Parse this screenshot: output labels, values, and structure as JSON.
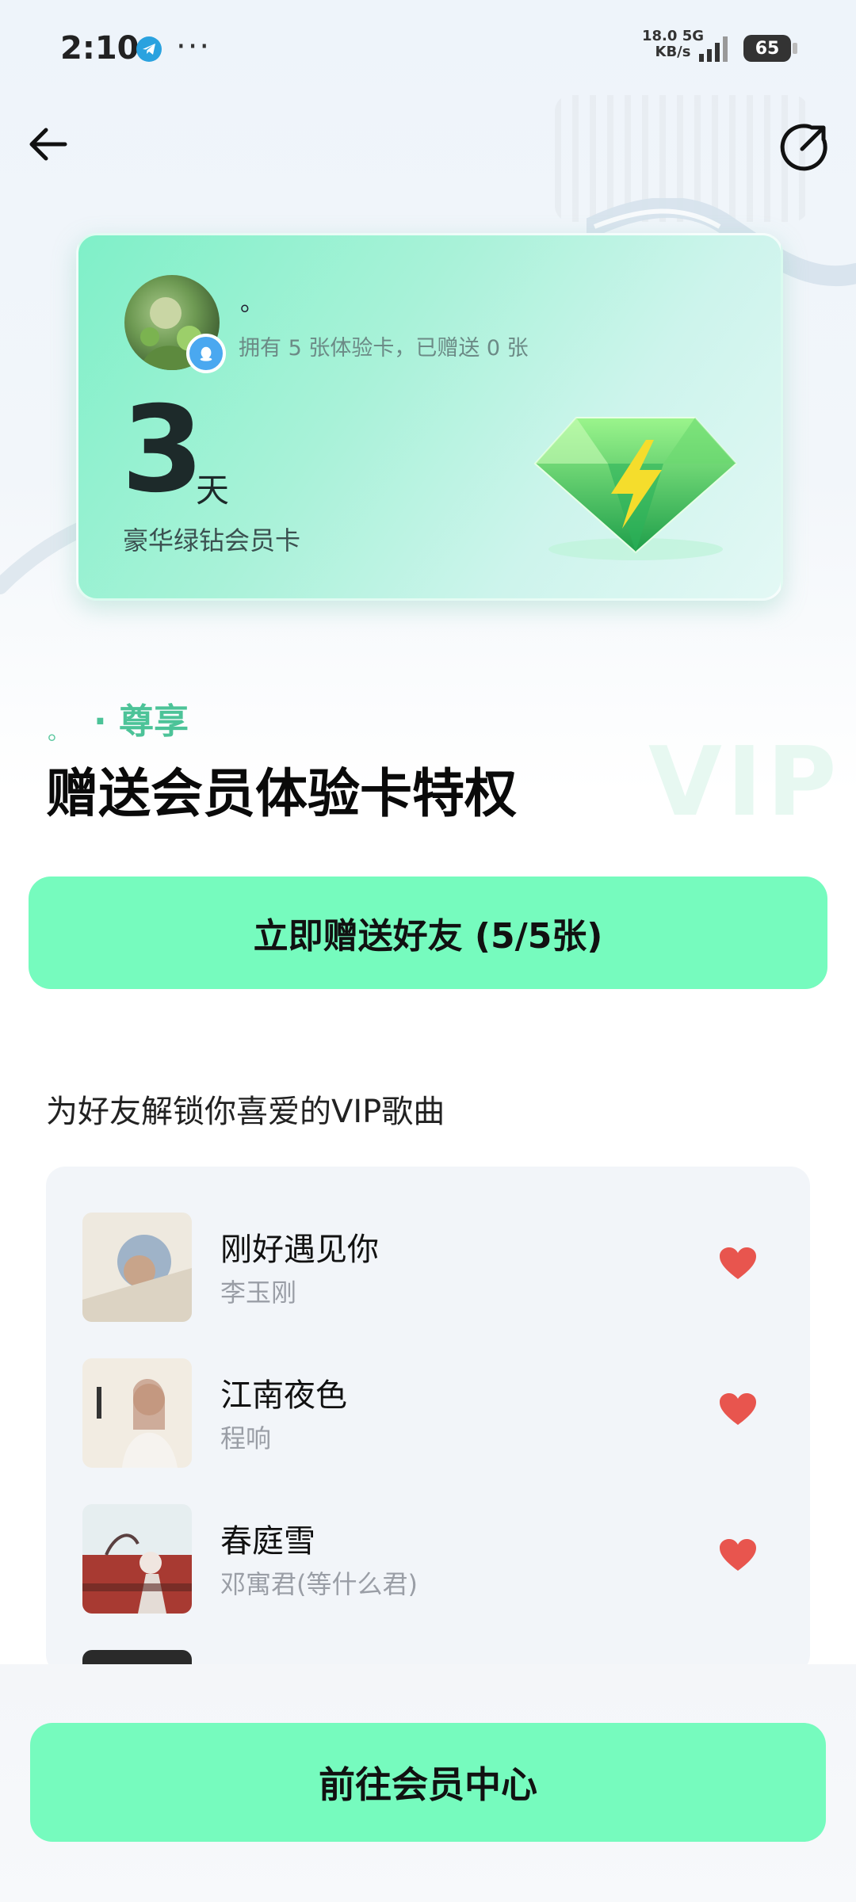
{
  "status_bar": {
    "time": "2:10",
    "more": "···",
    "net_speed": "18.0",
    "net_unit": "KB/s",
    "network": "5G",
    "battery": "65"
  },
  "card": {
    "user_name": "。",
    "user_info": "拥有 5 张体验卡，已赠送 0 张",
    "days_number": "3",
    "days_unit": "天",
    "card_type": "豪华绿钻会员卡"
  },
  "section": {
    "dot": "。",
    "subtitle": "· 尊享",
    "title": "赠送会员体验卡特权",
    "watermark": "VIP"
  },
  "gift_button_label": "立即赠送好友 (5/5张)",
  "songs": {
    "heading": "为好友解锁你喜爱的VIP歌曲",
    "items": [
      {
        "title": "刚好遇见你",
        "artist": "李玉刚"
      },
      {
        "title": "江南夜色",
        "artist": "程响"
      },
      {
        "title": "春庭雪",
        "artist": "邓寓君(等什么君)"
      }
    ]
  },
  "member_center_button_label": "前往会员中心",
  "colors": {
    "accent_green": "#76fbbe",
    "heart_red": "#e8554e",
    "title_green": "#4cc398"
  }
}
